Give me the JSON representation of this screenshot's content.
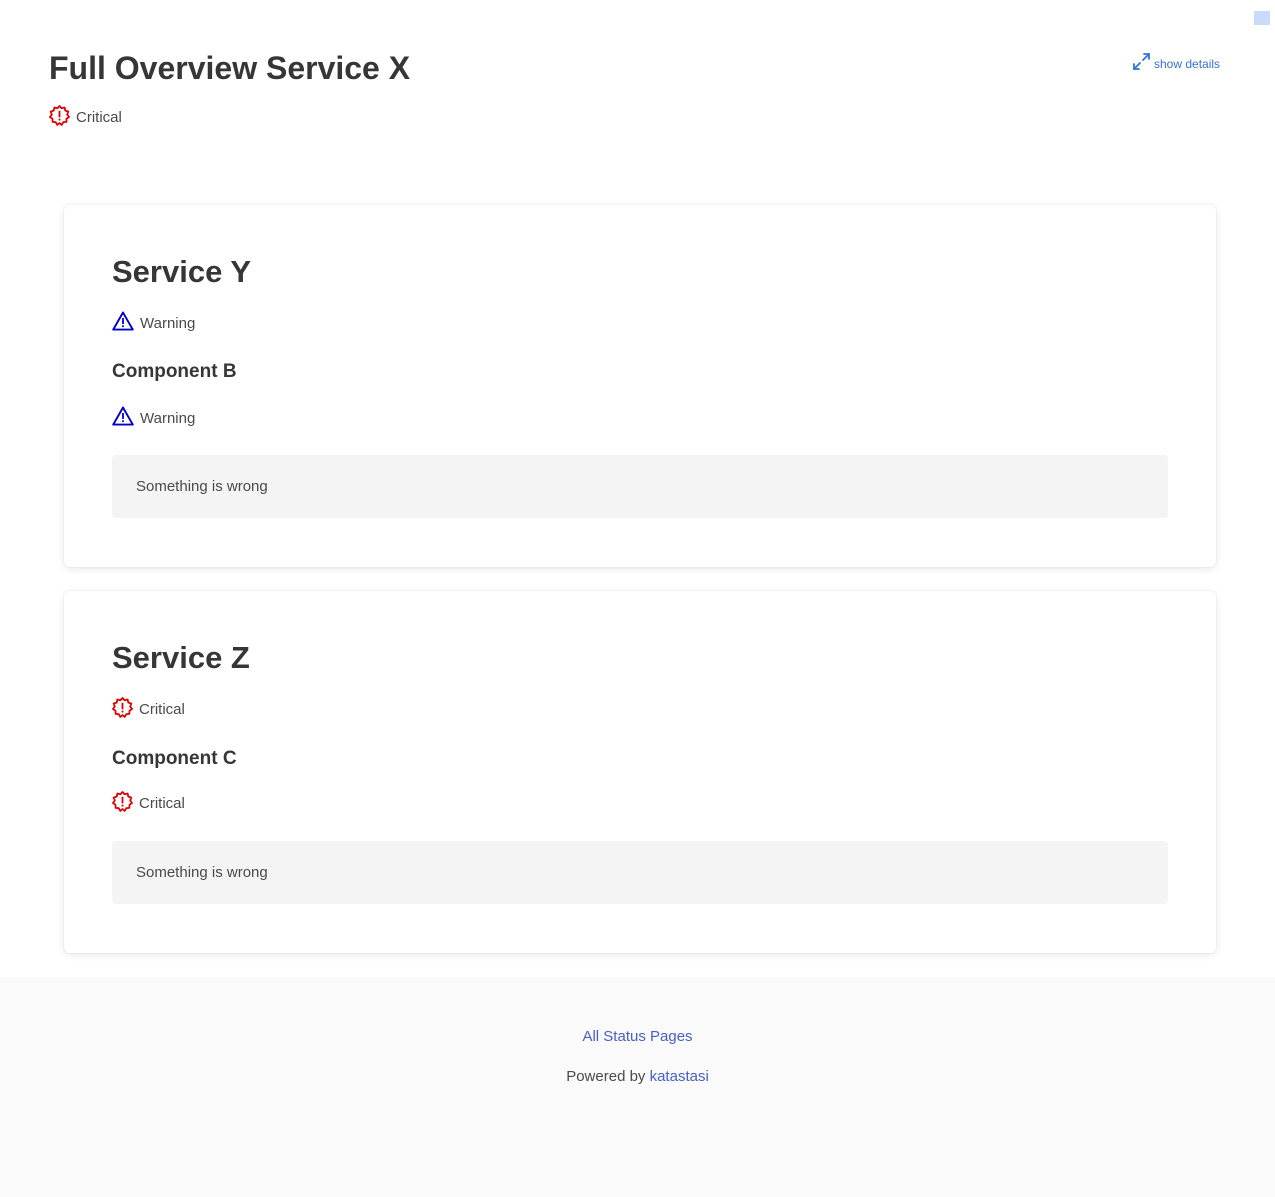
{
  "page": {
    "title": "Full Overview Service X",
    "status": {
      "label": "Critical",
      "icon": "critical-badge-icon",
      "color": "#e00000"
    },
    "details_link": {
      "label": "show details",
      "icon": "expand-arrows-icon",
      "color": "#3273dc"
    }
  },
  "services": [
    {
      "name": "Service Y",
      "status": {
        "label": "Warning",
        "icon": "warning-triangle-icon",
        "color": "#0000cc"
      },
      "component": {
        "name": "Component B",
        "status": {
          "label": "Warning",
          "icon": "warning-triangle-icon",
          "color": "#0000cc"
        },
        "message": "Something is wrong"
      }
    },
    {
      "name": "Service Z",
      "status": {
        "label": "Critical",
        "icon": "critical-badge-icon",
        "color": "#e00000"
      },
      "component": {
        "name": "Component C",
        "status": {
          "label": "Critical",
          "icon": "critical-badge-icon",
          "color": "#e00000"
        },
        "message": "Something is wrong"
      }
    }
  ],
  "footer": {
    "all_pages_link": "All Status Pages",
    "powered_prefix": "Powered by",
    "powered_link": "katastasi"
  }
}
